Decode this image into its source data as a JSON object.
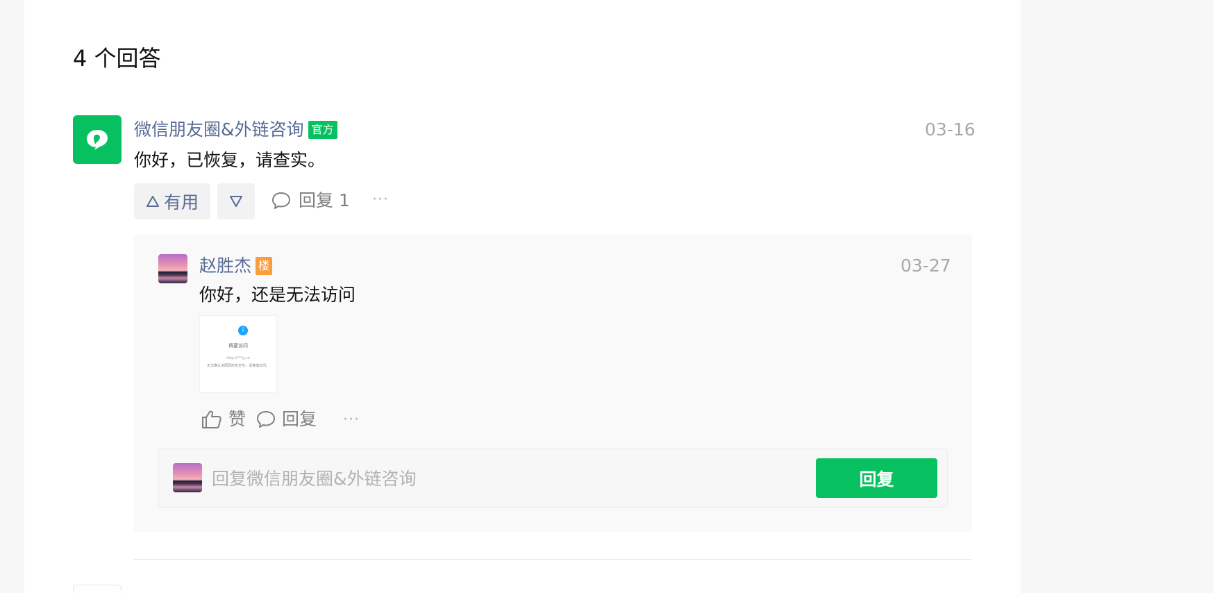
{
  "answers_header": {
    "count_label": "4 个回答"
  },
  "answer": {
    "author": "微信朋友圈&外链咨询",
    "author_badge": "官方",
    "date": "03-16",
    "text": "你好，已恢复，请查实。",
    "useful_label": "有用",
    "reply_label": "回复 1",
    "more_label": "···",
    "avatar_icon": "chat-bubble-icon"
  },
  "reply": {
    "author": "赵胜杰",
    "author_badge": "楼",
    "date": "03-27",
    "text": "你好，还是无法访问",
    "screenshot": {
      "line1": "将要访问",
      "line2": "http://***g.cn",
      "line3": "无法确认该网页的安全性，请谨慎访问。"
    },
    "like_label": "赞",
    "reply_label": "回复",
    "more_label": "···"
  },
  "reply_input": {
    "placeholder": "回复微信朋友圈&外链咨询",
    "value": "",
    "submit_label": "回复"
  },
  "colors": {
    "brand_green": "#07c160",
    "link_blue": "#576b95",
    "badge_orange": "#fa9d3b"
  }
}
